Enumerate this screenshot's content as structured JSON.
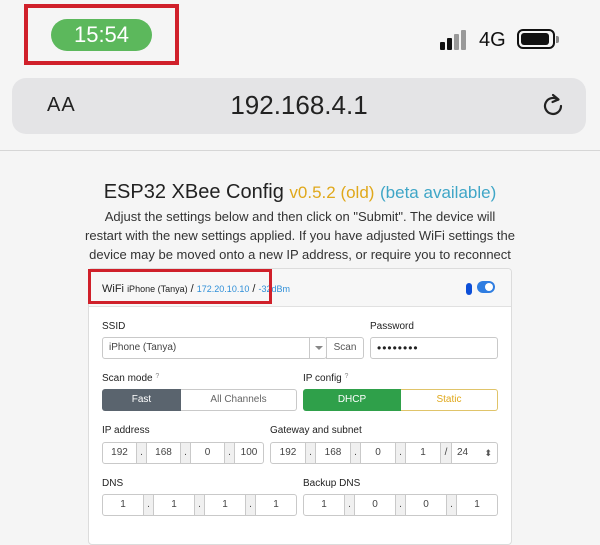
{
  "status_bar": {
    "time": "15:54",
    "network": "4G"
  },
  "url_bar": {
    "text_size_label": "AA",
    "url": "192.168.4.1"
  },
  "header": {
    "title": "ESP32 XBee Config",
    "version": "v0.5.2 (old)",
    "beta": "(beta available)",
    "intro": "Adjust the settings below and then click on \"Submit\". The device will restart with the new settings applied. If you have adjusted WiFi settings the device may be moved onto a new IP address, or require you to reconnect to its access point."
  },
  "wifi_card": {
    "title": "WiFi",
    "network_name": "iPhone (Tanya)",
    "sep1": " / ",
    "ip": "172.20.10.10",
    "sep2": " / ",
    "rssi": "-32dBm",
    "ssid_label": "SSID",
    "ssid_value": "iPhone (Tanya)",
    "scan_label": "Scan",
    "password_label": "Password",
    "password_value": "••••••••",
    "scan_mode_label": "Scan mode",
    "scan_mode_help": "?",
    "scan_mode_options": [
      "Fast",
      "All Channels"
    ],
    "ip_config_label": "IP config",
    "ip_config_help": "?",
    "ip_config_options": [
      "DHCP",
      "Static"
    ],
    "ip_address_label": "IP address",
    "ip_address": [
      "192",
      "168",
      "0",
      "100"
    ],
    "gateway_label": "Gateway and subnet",
    "gateway": [
      "192",
      "168",
      "0",
      "1"
    ],
    "subnet": "24",
    "dns_label": "DNS",
    "dns": [
      "1",
      "1",
      "1",
      "1"
    ],
    "backup_dns_label": "Backup DNS",
    "backup_dns": [
      "1",
      "0",
      "0",
      "1"
    ]
  },
  "colors": {
    "time_pill": "#5cb85c",
    "highlight_box": "#d0202a",
    "version_old": "#e0a81b",
    "beta_link": "#3fa6c7",
    "ip_link": "#2f8fd8",
    "dhcp_active": "#2fa04a",
    "fast_active": "#5a646e"
  }
}
